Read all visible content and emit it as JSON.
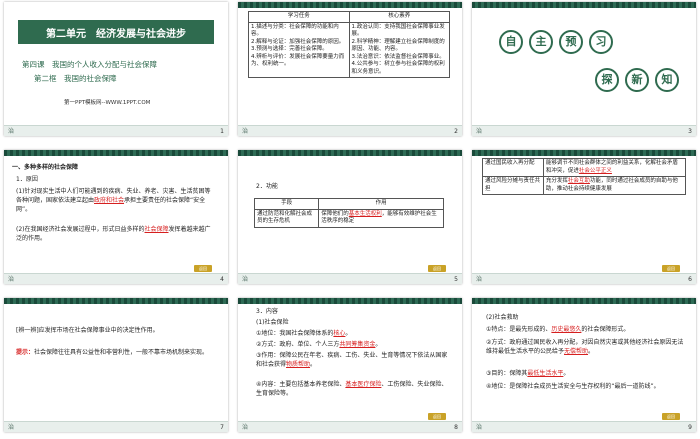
{
  "slide1": {
    "unit_title": "第二单元　经济发展与社会进步",
    "lesson": "第四课　我国的个人收入分配与社会保障",
    "section": "第二框　我国的社会保障",
    "site": "第一PPT模板网--WWW.1PPT.COM",
    "page": "1"
  },
  "slide2": {
    "headers": [
      "学习任务",
      "核心素养"
    ],
    "tasks": [
      "1.描述与分类：社会保障的功能和内容。",
      "2.解释与论证：加强社会保障的原因。",
      "3.预测与选择：完善社会保障。",
      "4.辨析与评价：发展社会保障要量力而为、权利统一。"
    ],
    "literacy": [
      "1.政治认同：支持我国社会保障事业发展。",
      "2.科学精神：理解建立社会保障制度的原因、功能、内容。",
      "3.法治意识：依法监督社会保障事业。",
      "4.公共参与：树立参与社会保障的权利和义务意识。"
    ],
    "page": "2"
  },
  "slide3": {
    "chars1": [
      "自",
      "主",
      "预",
      "习"
    ],
    "chars2": [
      "探",
      "新",
      "知"
    ],
    "page": "3"
  },
  "slide4": {
    "heading": "一、多种多样的社会保障",
    "sub1": "1．原因",
    "p1_a": "(1)针对现实生活中人们可能遇到的疾病、失业、养老、灾害、生活贫困等各种问题，国家依法建立起由",
    "p1_red": "政府和社会",
    "p1_b": "承担主要责任的社会保障“安全网”。",
    "p2_a": "(2)在我国经济社会发展过程中，形式日益多样的",
    "p2_red": "社会保障",
    "p2_b": "发挥着越来越广泛的作用。",
    "return": "返回",
    "page": "4"
  },
  "slide5": {
    "heading": "2．功能",
    "th_means": "手段",
    "th_effect": "作用",
    "row1_means": "通过防范和化解社会成员的生存危机",
    "row1_effect_a": "保障他们的",
    "row1_effect_red": "基本生活权利",
    "row1_effect_b": "，能够有效维护社会生活秩序的稳定",
    "return": "返回",
    "page": "5"
  },
  "slide6": {
    "row1_left": "通过国民收入再分配",
    "row1_right_a": "能够调节不同社会群体之间的利益关系，化解社会矛盾和冲突，促进",
    "row1_right_red": "社会公平正义",
    "row2_left": "通过风险分摊与责任共担",
    "row2_right_a": "充分发挥",
    "row2_right_red": "社会互助",
    "row2_right_b": "功能，同时通过社会成员的自助与他助，推动社会持续健康发展",
    "return": "返回",
    "page": "6"
  },
  "slide7": {
    "q": "[辨一辨]应发挥市场在社会保障事业中的决定性作用。",
    "hint_label": "提示：",
    "hint": "社会保障往往具有公益性和非营利性，一般不靠市场机制来实现。",
    "page": "7"
  },
  "slide8": {
    "heading": "3．内容",
    "sub": "(1)社会保险",
    "l1_a": "①地位：我国社会保障体系的",
    "l1_red": "核心",
    "l1_b": "。",
    "l2_a": "②方式：政府、单位、个人三方",
    "l2_red": "共同筹集资金",
    "l2_b": "。",
    "l3_a": "③作用：保障公民在年老、疾病、工伤、失业、生育等情况下依法从国家和社会获得",
    "l3_red": "物质帮助",
    "l3_b": "。",
    "l4_a": "④内容：主要包括基本养老保险、",
    "l4_red": "基本医疗保险",
    "l4_b": "、工伤保险、失业保险、生育保险等。",
    "return": "返回",
    "page": "8"
  },
  "slide9": {
    "sub": "(2)社会救助",
    "l1_a": "①特点：是最先形成的、",
    "l1_red": "历史最悠久",
    "l1_b": "的社会保障形式。",
    "l2_a": "②方式：政府通过国民收入再分配，对因自然灾害或其他经济社会原因无法维持最低生活水平的公民给予",
    "l2_red": "无偿帮助",
    "l2_b": "。",
    "l3_a": "③目的：保障其",
    "l3_red": "最低生活水平",
    "l3_b": "。",
    "l4": "④地位：是保障社会成员生活安全与生存权利的“最后一道防线”。",
    "return": "返回",
    "page": "9"
  }
}
